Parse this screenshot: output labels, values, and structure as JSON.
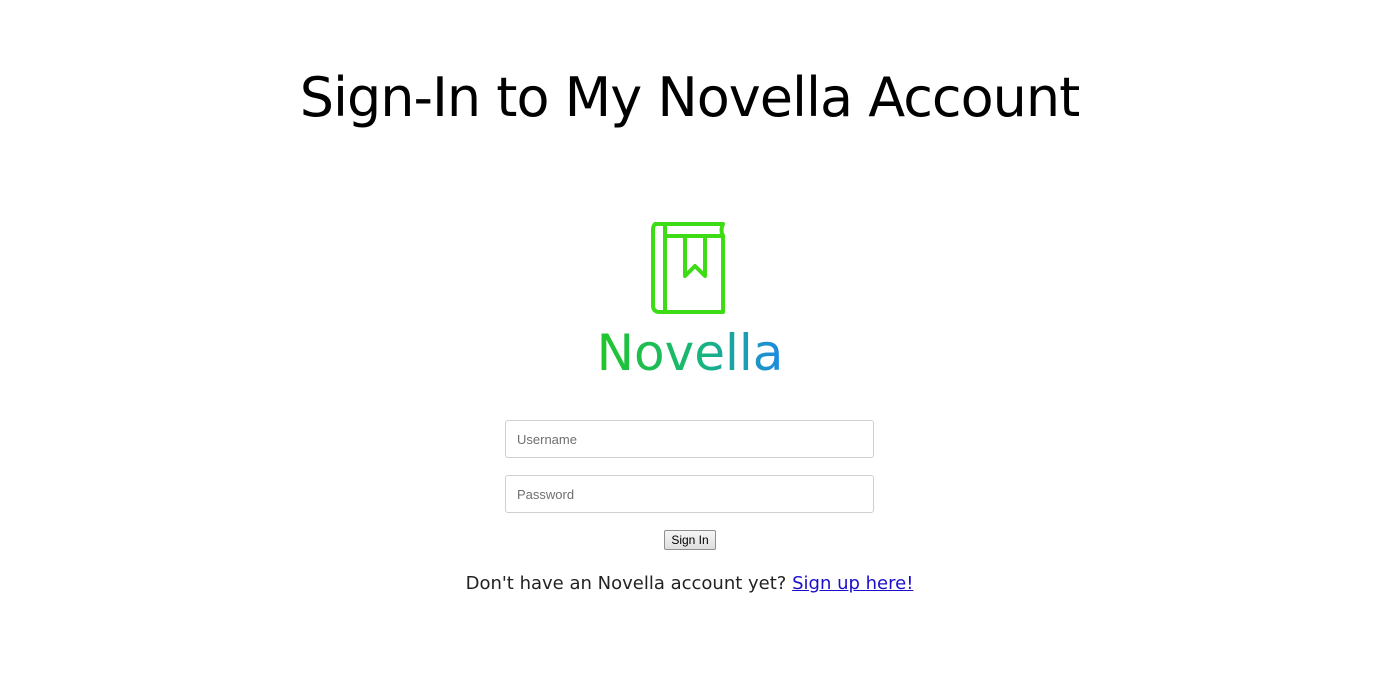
{
  "page": {
    "title": "Sign-In to My Novella Account"
  },
  "logo": {
    "icon": "book-bookmark-icon",
    "wordmark": "Novella",
    "colors": {
      "icon": "#3ddc15",
      "gradient_start": "#22c62a",
      "gradient_end": "#1e88e5"
    }
  },
  "form": {
    "username_placeholder": "Username",
    "password_placeholder": "Password",
    "submit_label": "Sign In"
  },
  "signup": {
    "prompt": "Don't have an Novella account yet? ",
    "link_label": "Sign up here!"
  }
}
